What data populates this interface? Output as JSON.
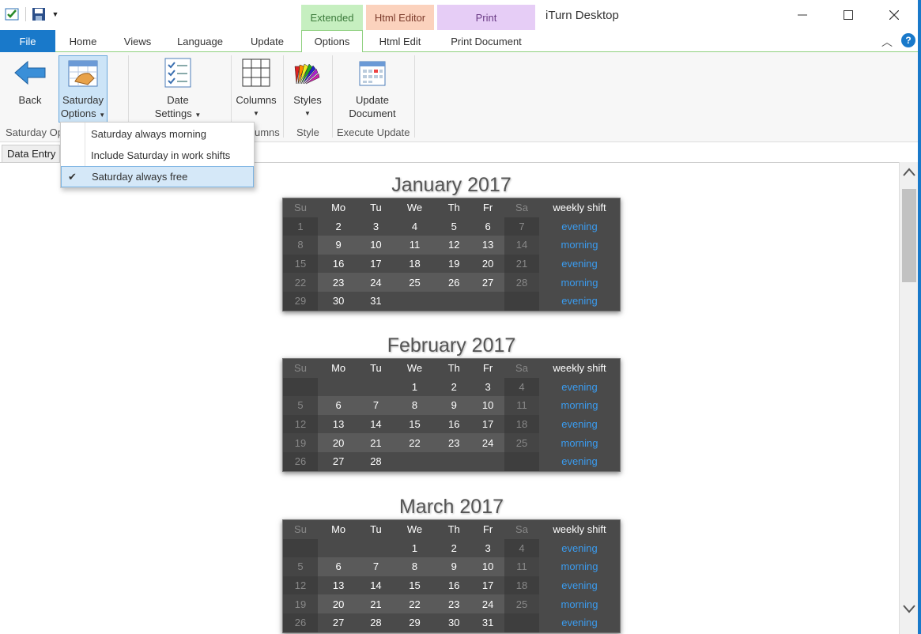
{
  "window": {
    "title": "iTurn Desktop"
  },
  "context_groups": [
    "Extended",
    "Html Editor",
    "Print"
  ],
  "tabs": {
    "file": "File",
    "home": "Home",
    "views": "Views",
    "language": "Language",
    "update": "Update",
    "options": "Options",
    "html_edit": "Html Edit",
    "print_document": "Print Document"
  },
  "ribbon": {
    "back": "Back",
    "saturday_options": [
      "Saturday",
      "Options"
    ],
    "date_settings": [
      "Date",
      "Settings"
    ],
    "columns": "Columns",
    "styles": "Styles",
    "update_document": [
      "Update",
      "Document"
    ],
    "groups": {
      "saturday_options": "Saturday Op",
      "columns": "umns",
      "style": "Style",
      "execute_update": "Execute Update"
    }
  },
  "saturday_menu": {
    "items": [
      "Saturday always morning",
      "Include Saturday in work shifts",
      "Saturday always free"
    ],
    "checked_index": 2
  },
  "document_tab": "Data Entry",
  "weekday_headers": [
    "Su",
    "Mo",
    "Tu",
    "We",
    "Th",
    "Fr",
    "Sa",
    "weekly shift"
  ],
  "months": [
    {
      "title": "January 2017",
      "rows": [
        [
          "1",
          "2",
          "3",
          "4",
          "5",
          "6",
          "7",
          "evening"
        ],
        [
          "8",
          "9",
          "10",
          "11",
          "12",
          "13",
          "14",
          "morning"
        ],
        [
          "15",
          "16",
          "17",
          "18",
          "19",
          "20",
          "21",
          "evening"
        ],
        [
          "22",
          "23",
          "24",
          "25",
          "26",
          "27",
          "28",
          "morning"
        ],
        [
          "29",
          "30",
          "31",
          "",
          "",
          "",
          "",
          "evening"
        ]
      ]
    },
    {
      "title": "February 2017",
      "rows": [
        [
          "",
          "",
          "",
          "1",
          "2",
          "3",
          "4",
          "evening"
        ],
        [
          "5",
          "6",
          "7",
          "8",
          "9",
          "10",
          "11",
          "morning"
        ],
        [
          "12",
          "13",
          "14",
          "15",
          "16",
          "17",
          "18",
          "evening"
        ],
        [
          "19",
          "20",
          "21",
          "22",
          "23",
          "24",
          "25",
          "morning"
        ],
        [
          "26",
          "27",
          "28",
          "",
          "",
          "",
          "",
          "evening"
        ]
      ]
    },
    {
      "title": "March 2017",
      "rows": [
        [
          "",
          "",
          "",
          "1",
          "2",
          "3",
          "4",
          "evening"
        ],
        [
          "5",
          "6",
          "7",
          "8",
          "9",
          "10",
          "11",
          "morning"
        ],
        [
          "12",
          "13",
          "14",
          "15",
          "16",
          "17",
          "18",
          "evening"
        ],
        [
          "19",
          "20",
          "21",
          "22",
          "23",
          "24",
          "25",
          "morning"
        ],
        [
          "26",
          "27",
          "28",
          "29",
          "30",
          "31",
          "",
          "evening"
        ]
      ]
    }
  ],
  "colors": {
    "file_tab": "#1979ca",
    "shift_text": "#3a9cf0",
    "calendar_bg": "#4a4a4a"
  }
}
